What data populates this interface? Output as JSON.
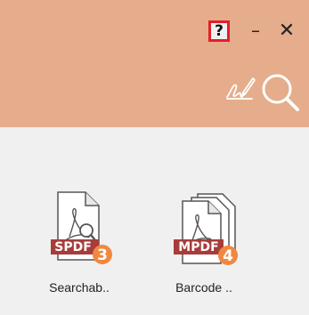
{
  "header": {
    "background_color": "#e5ad8b",
    "controls": {
      "help_label": "?",
      "minimize_label": "–",
      "close_label": "✕"
    },
    "tools": {
      "sign_icon": "signature-icon",
      "search_icon": "search-icon"
    }
  },
  "files": [
    {
      "name": "Searchab..",
      "tag": "SPDF",
      "count": "3",
      "icon": "searchable-pdf-icon"
    },
    {
      "name": "Barcode ..",
      "tag": "MPDF",
      "count": "4",
      "icon": "multi-pdf-icon"
    }
  ],
  "colors": {
    "tag_background": "#a63d3b",
    "badge": "#f0883f"
  }
}
